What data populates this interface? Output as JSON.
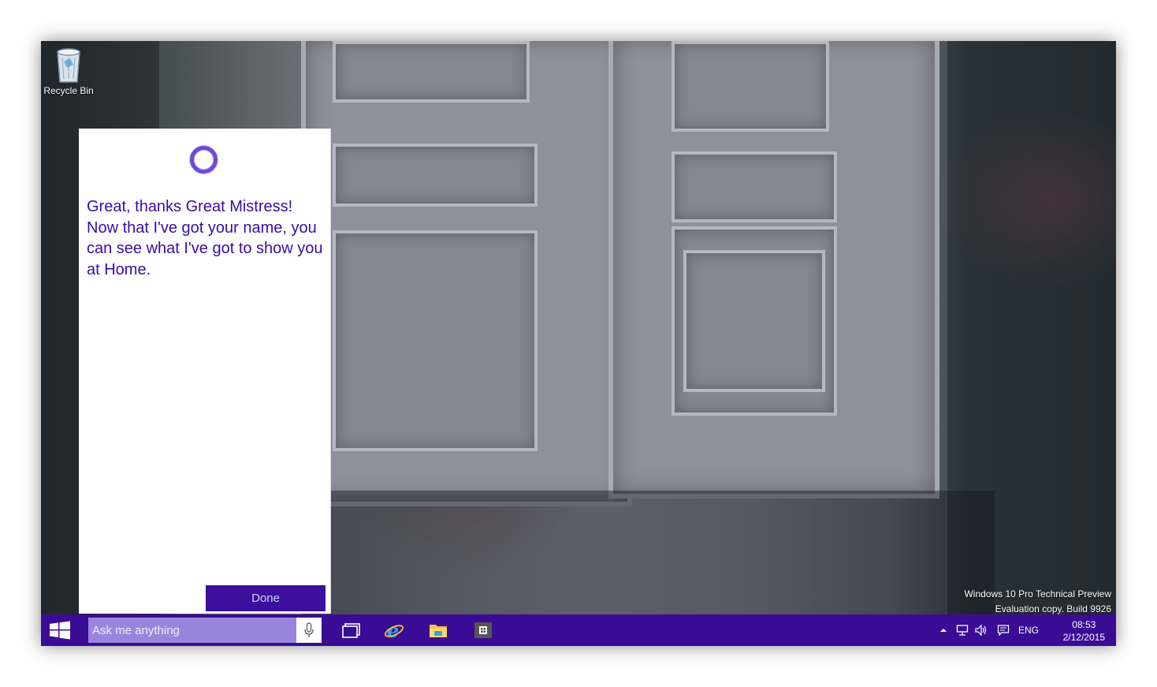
{
  "desktop": {
    "icons": [
      {
        "label": "Recycle Bin",
        "icon": "recycle-bin-icon"
      }
    ],
    "watermark": {
      "line1": "Windows 10 Pro Technical Preview",
      "line2": "Evaluation copy. Build 9926"
    }
  },
  "cortana": {
    "icon": "cortana-ring-icon",
    "message": "Great, thanks Great Mistress! Now that I've got your name, you can see what I've got to show you at Home.",
    "done_label": "Done",
    "accent": "#3a0ca3"
  },
  "taskbar": {
    "color": "#3a0c96",
    "start_icon": "windows-logo-icon",
    "search": {
      "placeholder": "Ask me anything",
      "mic_icon": "microphone-icon"
    },
    "apps": [
      {
        "name": "Task View",
        "icon": "task-view-icon"
      },
      {
        "name": "Internet Explorer",
        "icon": "internet-explorer-icon"
      },
      {
        "name": "File Explorer",
        "icon": "file-explorer-icon"
      },
      {
        "name": "Store",
        "icon": "store-icon"
      }
    ],
    "tray": {
      "chevron_icon": "chevron-up-icon",
      "network_icon": "network-icon",
      "volume_icon": "volume-icon",
      "notifications_icon": "action-center-icon",
      "language": "ENG",
      "time": "08:53",
      "date": "2/12/2015"
    }
  }
}
